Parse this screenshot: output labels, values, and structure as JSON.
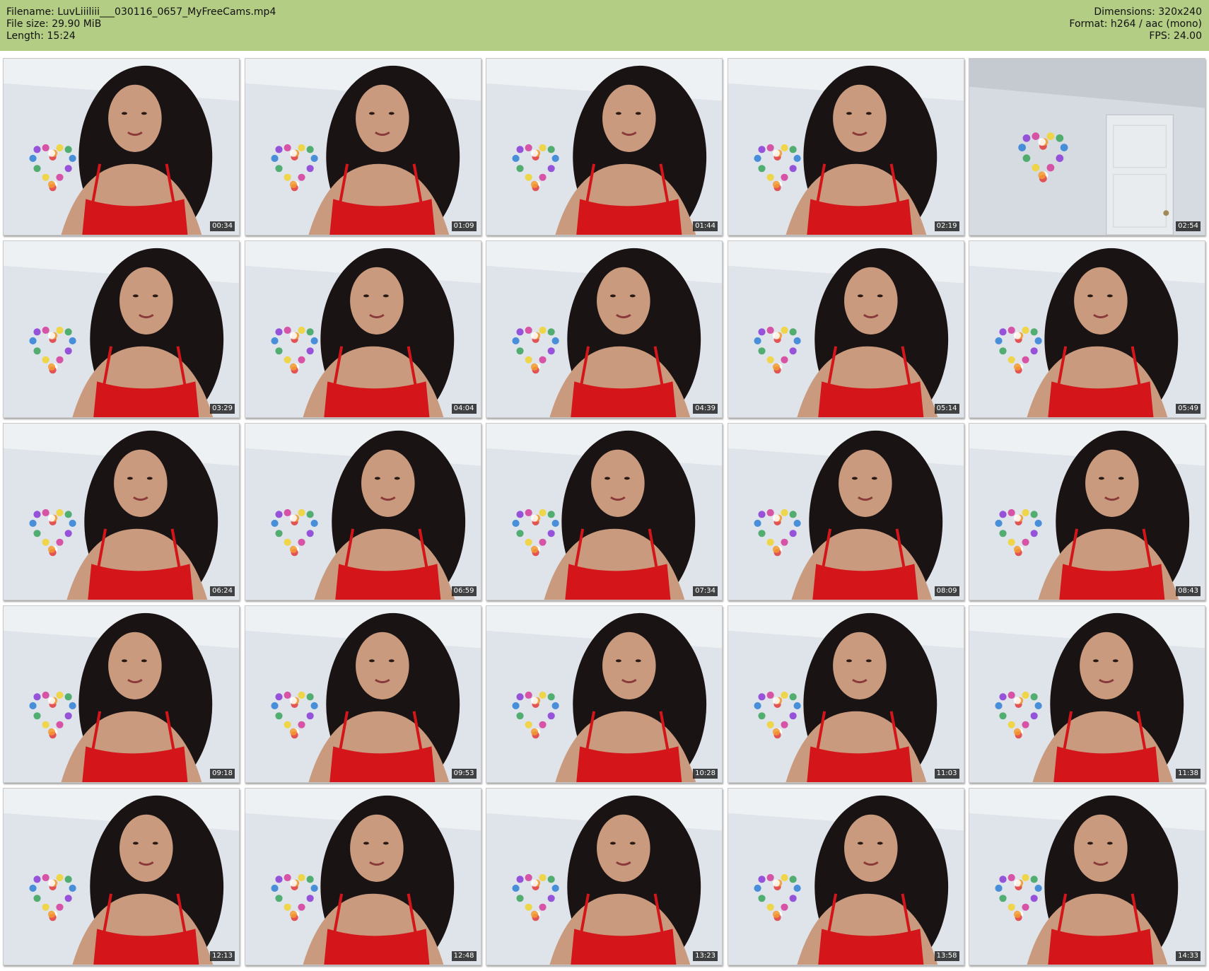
{
  "header": {
    "left": [
      "Filename: LuvLiiiliii___030116_0657_MyFreeCams.mp4",
      "File size: 29.90 MiB",
      "Length: 15:24"
    ],
    "right": [
      "Dimensions: 320x240",
      "Format: h264 / aac (mono)",
      "FPS: 24.00"
    ]
  },
  "colors": {
    "header_bg": "#b3cd84",
    "wall": "#dfe4ea",
    "dress": "#d4161b",
    "hair": "#1a1313",
    "skin": "#c99a7e"
  },
  "thumbnails": [
    {
      "time": "00:34",
      "scene": "person"
    },
    {
      "time": "01:09",
      "scene": "person"
    },
    {
      "time": "01:44",
      "scene": "person"
    },
    {
      "time": "02:19",
      "scene": "person"
    },
    {
      "time": "02:54",
      "scene": "room-door"
    },
    {
      "time": "03:29",
      "scene": "person"
    },
    {
      "time": "04:04",
      "scene": "person"
    },
    {
      "time": "04:39",
      "scene": "person"
    },
    {
      "time": "05:14",
      "scene": "person"
    },
    {
      "time": "05:49",
      "scene": "person"
    },
    {
      "time": "06:24",
      "scene": "person"
    },
    {
      "time": "06:59",
      "scene": "person"
    },
    {
      "time": "07:34",
      "scene": "person"
    },
    {
      "time": "08:09",
      "scene": "person"
    },
    {
      "time": "08:43",
      "scene": "person"
    },
    {
      "time": "09:18",
      "scene": "person"
    },
    {
      "time": "09:53",
      "scene": "person"
    },
    {
      "time": "10:28",
      "scene": "person"
    },
    {
      "time": "11:03",
      "scene": "person"
    },
    {
      "time": "11:38",
      "scene": "person"
    },
    {
      "time": "12:13",
      "scene": "person"
    },
    {
      "time": "12:48",
      "scene": "person"
    },
    {
      "time": "13:23",
      "scene": "person"
    },
    {
      "time": "13:58",
      "scene": "person"
    },
    {
      "time": "14:33",
      "scene": "person"
    }
  ]
}
